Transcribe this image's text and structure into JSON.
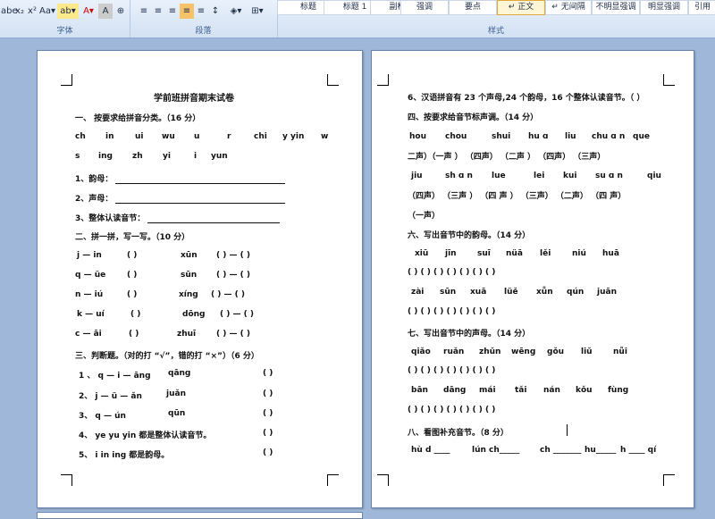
{
  "ribbon": {
    "font_buttons": [
      "abe",
      "x₂",
      "x²",
      "Aa▾",
      "ab▾",
      "A▾",
      "A",
      "⊕"
    ],
    "group_font": "字体",
    "group_paragraph": "段落",
    "group_styles": "样式",
    "styles": [
      "标题",
      "标题 1",
      "副标题",
      "强调",
      "要点",
      "↵ 正文",
      "↵ 无间隔",
      "不明显强调",
      "明显强调",
      "引用"
    ]
  },
  "left": {
    "title": "学前班拼音期末试卷",
    "s1": "一、 按要求给拼音分类。（16 分）",
    "row1": [
      "ch",
      "in",
      "ui",
      "wu",
      "u",
      "r",
      "chi",
      "y yin",
      "w"
    ],
    "row2": [
      "s",
      "ing",
      "zh",
      "yi",
      "i",
      "yun"
    ],
    "q1": "1、韵母：",
    "q2": "2、声母：",
    "q3": "3、整体认读音节：",
    "s2": "二、拼一拼，写一写。（10 分）",
    "p1": [
      "j — in",
      "(      )",
      "xūn",
      "(    ) — (    )"
    ],
    "p2": [
      "q — üe",
      "(      )",
      "sūn",
      "(    ) — (    )"
    ],
    "p3": [
      "n — iú",
      "(      )",
      "xíng",
      "(    ) — (    )"
    ],
    "p4": [
      "k — uí",
      "(      )",
      "dōng",
      "(    ) — (    )"
    ],
    "p5": [
      "c — āi",
      "(      )",
      "zhuī",
      "(    ) — (    )"
    ],
    "s3": "三、判断题。（对的打 “√”，错的打 “×”）（6 分）",
    "j1": [
      "1 、 q — i — āng",
      "qāng",
      "(      )"
    ],
    "j2": [
      "2、 j — ü — ǎn",
      "juǎn",
      "(      )"
    ],
    "j3": [
      "3、 q — ún",
      "qūn",
      "(      )"
    ],
    "j4": [
      "4、 ye    yu    yin  都是整体认读音节。",
      "(      )"
    ],
    "j5": [
      "5、 i    in    ing 都是韵母。",
      "(      )"
    ]
  },
  "right": {
    "l1": "6、汉语拼音有 23 个声母,24 个韵母，16 个整体认读音节。（ ）",
    "s4": "四、按要求给音节标声调。（14 分）",
    "r1": [
      "hou",
      "chou",
      "shui",
      "hu ɑ",
      "liu",
      "chu ɑ n",
      "que"
    ],
    "r2": "二声）（一声 ）  （四声）  （二声 ）  （四声）    （三声）",
    "r3": [
      "jiu",
      "sh ɑ n",
      "lue",
      "lei",
      "kui",
      "su ɑ n",
      "qiu"
    ],
    "r4": "（四声）  （三声 ）  （四 声 ）  （三声）  （二声）    （四 声）",
    "r5": "（一声）",
    "s6": "六、写出音节中的韵母。（14 分）",
    "y1": [
      "xiū",
      "jīn",
      "suī",
      "nüā",
      "lěi",
      "niú",
      "huā"
    ],
    "y2": "(     )    (     )    (     )    (     )    (     )    (     )    (     )",
    "y3": [
      "zài",
      "sūn",
      "xuā",
      "lüě",
      "xǖn",
      "qún",
      "juān"
    ],
    "y4": "(     )    (     )    (     )    (     )    (     )    (     )    (     )",
    "s7": "七、写出音节中的声母。（14 分）",
    "m1": [
      "qiǎo",
      "ruǎn",
      "zhǔn",
      "wēng",
      "gǒu",
      "liǔ",
      "nǚi"
    ],
    "m2": "(     )    (     )    (     )    (     )    (     )    (     )    (     )",
    "m3": [
      "bān",
      "dāng",
      "mái",
      "tǎi",
      "nán",
      "kǒu",
      "fùng"
    ],
    "m4": "(     )    (     )    (     )    (     )    (     )    (     )    (     )",
    "s8": "八、看图补充音节。（8 分）",
    "b1": [
      "hù  d ____",
      "lún  ch_____",
      "ch _______",
      "hu_____",
      "h  ____  qí"
    ]
  }
}
